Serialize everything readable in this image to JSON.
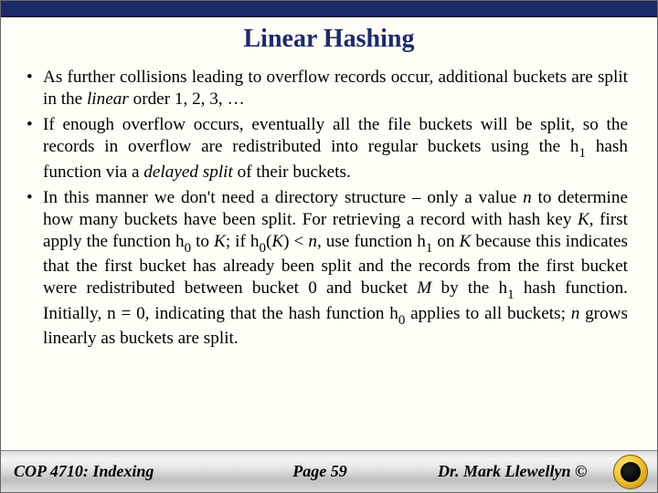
{
  "title": "Linear Hashing",
  "bullets": [
    {
      "pre": "As further collisions leading to overflow records occur, additional buckets are split in the ",
      "ital1": "linear",
      "post": " order 1, 2,  3, …"
    },
    {
      "pre": "If enough overflow occurs, eventually all the file buckets will be split, so the records in overflow are redistributed into regular buckets using the h",
      "sub1": "1",
      "mid1": " hash function via a ",
      "ital1": "delayed split",
      "post": " of their buckets."
    },
    {
      "pre": "In this manner we don't need a directory structure – only a value ",
      "ital1": "n",
      "mid1": " to determine how many buckets have been split.  For retrieving a record with hash key ",
      "ital2": "K",
      "mid2": ", first apply the function h",
      "sub1": "0",
      "mid3": " to ",
      "ital3": "K",
      "mid4": "; if h",
      "sub2": "0",
      "mid5": "(",
      "ital4": "K",
      "mid6": ") < ",
      "ital5": "n",
      "mid7": ", use function h",
      "sub3": "1",
      "mid8": " on ",
      "ital6": "K",
      "mid9": " because this indicates that the first bucket has already been split and the records from the first bucket were redistributed between bucket 0 and bucket ",
      "ital7": "M",
      "mid10": " by the h",
      "sub4": "1",
      "mid11": " hash function.  Initially, n = 0, indicating that the hash function h",
      "sub5": "0",
      "mid12": " applies to all buckets; ",
      "ital8": "n",
      "post": " grows linearly as buckets are split."
    }
  ],
  "footer": {
    "left": "COP 4710: Indexing",
    "center": "Page 59",
    "right": "Dr. Mark Llewellyn ©"
  }
}
